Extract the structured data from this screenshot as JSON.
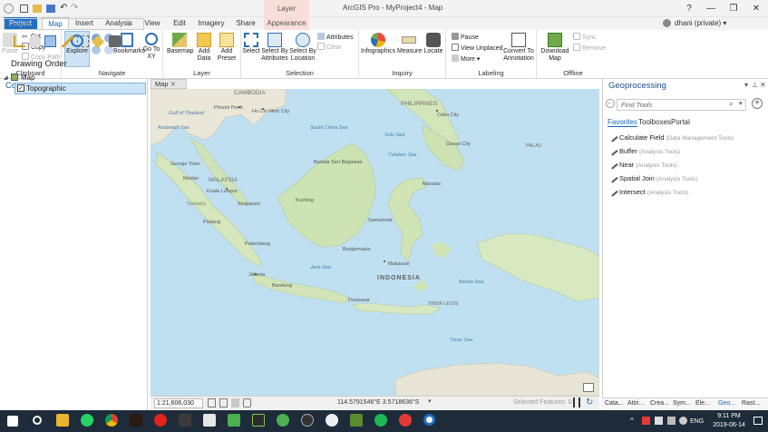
{
  "window": {
    "title": "ArcGIS Pro - MyProject4 - Map",
    "context_header": "Layer",
    "help": "?",
    "minimize": "—",
    "restore": "❐",
    "close": "✕"
  },
  "tabs": [
    "Project",
    "Map",
    "Insert",
    "Analysis",
    "View",
    "Edit",
    "Imagery",
    "Share",
    "Appearance"
  ],
  "user": "dhani (private) ▾",
  "ribbon": {
    "clipboard": {
      "label": "Clipboard",
      "paste": "Paste",
      "cut": "Cut",
      "copy": "Copy",
      "copy_path": "Copy Path"
    },
    "navigate": {
      "label": "Navigate",
      "explore": "Explore",
      "bookmarks": "Bookmarks",
      "goto": "Go To XY"
    },
    "layer": {
      "label": "Layer",
      "basemap": "Basemap",
      "add_data": "Add Data",
      "add_preset": "Add Preset"
    },
    "selection": {
      "label": "Selection",
      "select": "Select",
      "by_attr": "Select By Attributes",
      "by_loc": "Select By Location",
      "attributes": "Attributes",
      "clear": "Clear"
    },
    "inquiry": {
      "label": "Inquiry",
      "infographics": "Infographics",
      "measure": "Measure",
      "locate": "Locate"
    },
    "labeling": {
      "label": "Labeling",
      "pause": "Pause",
      "view_unplaced": "View Unplaced",
      "more": "More",
      "convert": "Convert To Annotation"
    },
    "offline": {
      "label": "Offline",
      "download": "Download Map",
      "sync": "Sync",
      "remove": "Remove"
    }
  },
  "contents": {
    "title": "Contents",
    "search_placeholder": "Search",
    "drawing_order": "Drawing Order",
    "map_item": "Map",
    "layer_item": "Topographic"
  },
  "map": {
    "tab": "Map",
    "scale": "1:21,606,030",
    "coords": "114.5791546°E 3.5718636°S",
    "selected": "Selected Features: 0",
    "labels": {
      "cambodia": "CAMBODIA",
      "philippines": "PHILIPPINES",
      "indonesia": "INDONESIA",
      "malaysia": "MALAYSIA",
      "palau": "PALAU",
      "phnom_penh": "Phnom Penh",
      "ho_chi_minh": "Ho Chi Minh City",
      "thailand": "Gulf of Thailand",
      "cebu": "Cebu City",
      "davao": "Davao City",
      "george_town": "George Town",
      "medan": "Medan",
      "kuala_lumpur": "Kuala Lumpur",
      "singapore": "Singapore",
      "padang": "Padang",
      "palembang": "Palembang",
      "jakarta": "Jakarta",
      "bandung": "Bandung",
      "denpasar": "Denpasar",
      "kuching": "Kuching",
      "bandar": "Bandar Seri Begawan",
      "samarinda": "Samarinda",
      "banjarmasin": "Banjarmasin",
      "manado": "Manado",
      "makassar": "Makassar",
      "java_sea": "Java Sea",
      "timor": "TIMOR-LESTE",
      "banda_sea": "Banda Sea",
      "celebes": "Celebes Sea",
      "sulu": "Sulu Sea",
      "south_china": "South China Sea",
      "timor_sea": "Timor Sea",
      "sumatra": "Sumatra",
      "andaman": "Andaman Sea"
    }
  },
  "geoprocessing": {
    "title": "Geoprocessing",
    "find_placeholder": "Find Tools",
    "tabs": [
      "Favorites",
      "Toolboxes",
      "Portal"
    ],
    "tools": [
      {
        "name": "Calculate Field",
        "box": "(Data Management Tools)"
      },
      {
        "name": "Buffer",
        "box": "(Analysis Tools)"
      },
      {
        "name": "Near",
        "box": "(Analysis Tools)"
      },
      {
        "name": "Spatial Join",
        "box": "(Analysis Tools)"
      },
      {
        "name": "Intersect",
        "box": "(Analysis Tools)"
      }
    ],
    "bottom_tabs": [
      "Cata...",
      "Attri...",
      "Crea...",
      "Sym...",
      "Ele...",
      "Geo...",
      "Rast..."
    ]
  },
  "taskbar": {
    "lang": "ENG",
    "time": "9:11 PM",
    "date": "2019-06-14"
  }
}
